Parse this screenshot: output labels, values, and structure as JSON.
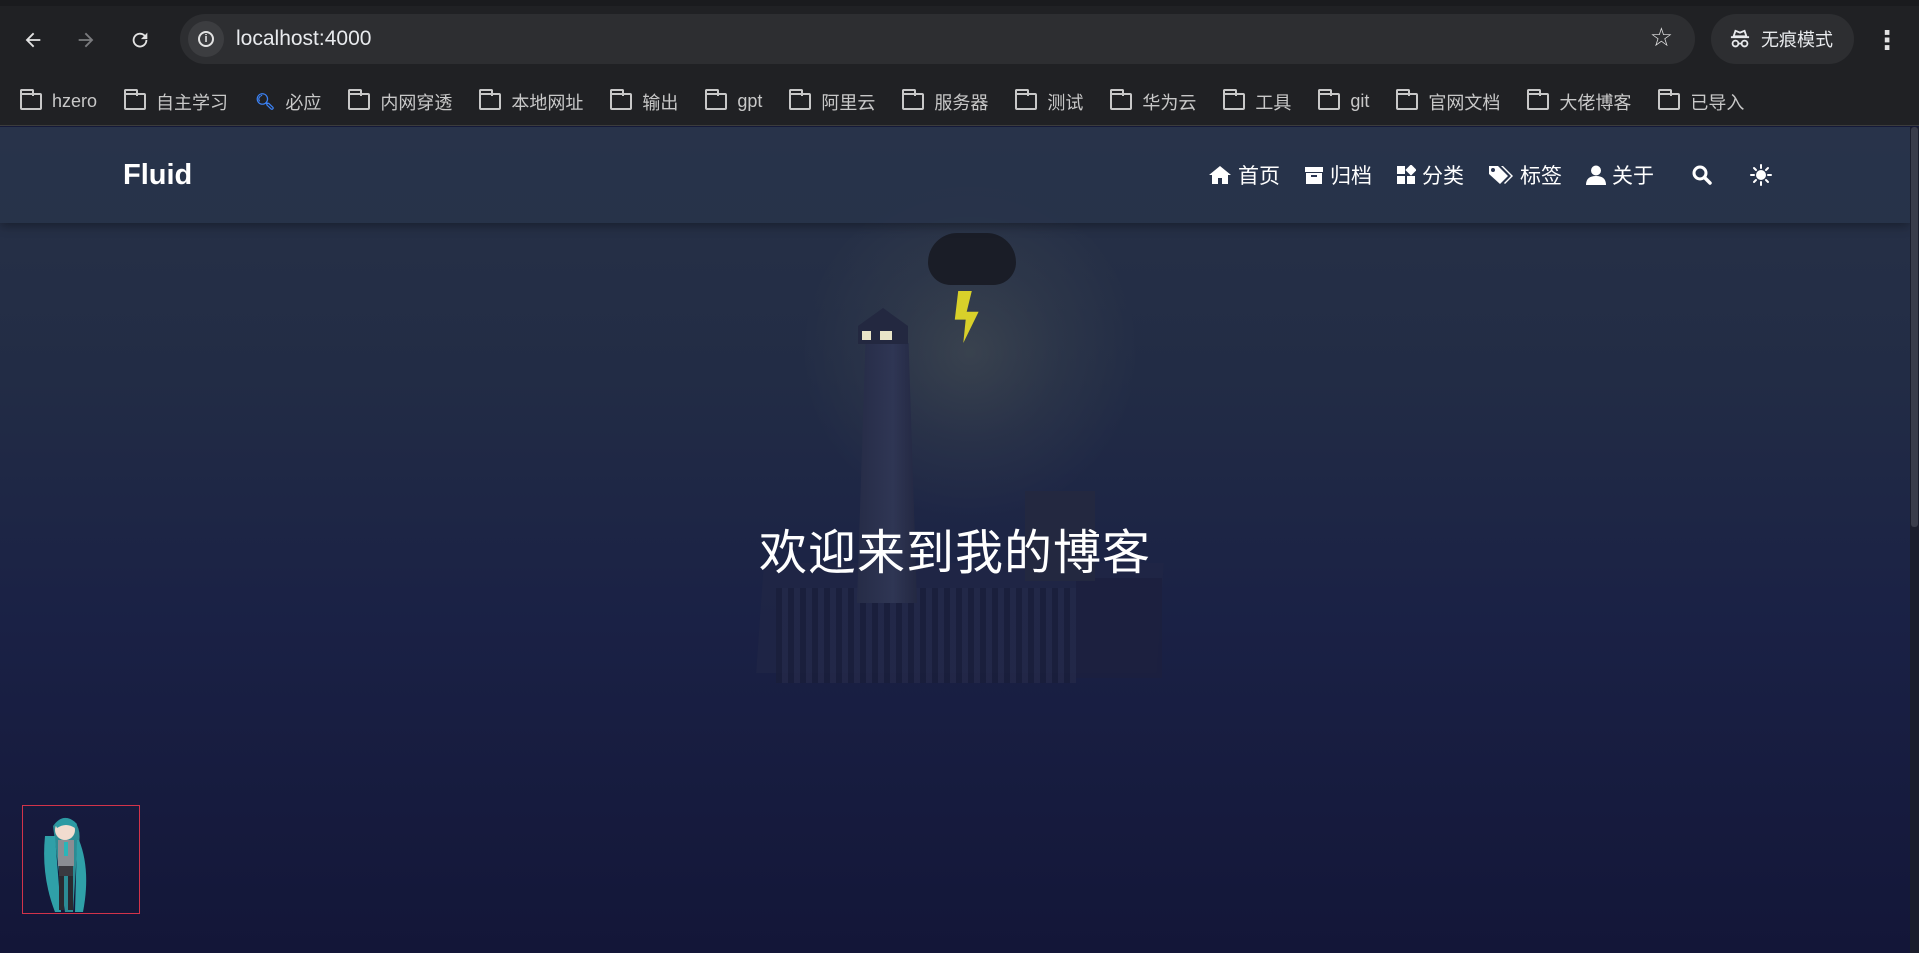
{
  "browser": {
    "url": "localhost:4000",
    "incognito_label": "无痕模式",
    "icons": {
      "back": "back-arrow-icon",
      "forward": "forward-arrow-icon",
      "reload": "reload-icon",
      "info": "info-icon",
      "bookmark_star": "star-icon",
      "incognito": "incognito-icon",
      "menu": "more-vert-icon"
    }
  },
  "bookmarks": [
    {
      "label": "hzero",
      "icon": "folder-icon"
    },
    {
      "label": "自主学习",
      "icon": "folder-icon"
    },
    {
      "label": "必应",
      "icon": "search-icon"
    },
    {
      "label": "内网穿透",
      "icon": "folder-icon"
    },
    {
      "label": "本地网址",
      "icon": "folder-icon"
    },
    {
      "label": "输出",
      "icon": "folder-icon"
    },
    {
      "label": "gpt",
      "icon": "folder-icon"
    },
    {
      "label": "阿里云",
      "icon": "folder-icon"
    },
    {
      "label": "服务器",
      "icon": "folder-icon"
    },
    {
      "label": "测试",
      "icon": "folder-icon"
    },
    {
      "label": "华为云",
      "icon": "folder-icon"
    },
    {
      "label": "工具",
      "icon": "folder-icon"
    },
    {
      "label": "git",
      "icon": "folder-icon"
    },
    {
      "label": "官网文档",
      "icon": "folder-icon"
    },
    {
      "label": "大佬博客",
      "icon": "folder-icon"
    },
    {
      "label": "已导入",
      "icon": "folder-icon"
    }
  ],
  "site": {
    "brand": "Fluid",
    "nav": [
      {
        "label": "首页",
        "icon": "home-icon"
      },
      {
        "label": "归档",
        "icon": "archive-icon"
      },
      {
        "label": "分类",
        "icon": "category-icon"
      },
      {
        "label": "标签",
        "icon": "tags-icon"
      },
      {
        "label": "关于",
        "icon": "user-icon"
      }
    ],
    "search_icon": "search-icon",
    "theme_icon": "sun-icon",
    "hero_title": "欢迎来到我的博客",
    "scroll_icon": "chevron-down-icon",
    "mascot": "live2d-mascot"
  },
  "colors": {
    "chrome_bg": "#202124",
    "omnibox_bg": "#2d2e31",
    "page_top": "#283247",
    "page_bottom": "#131638",
    "bolt": "#d8d02a",
    "mascot_border": "#d2334a"
  }
}
